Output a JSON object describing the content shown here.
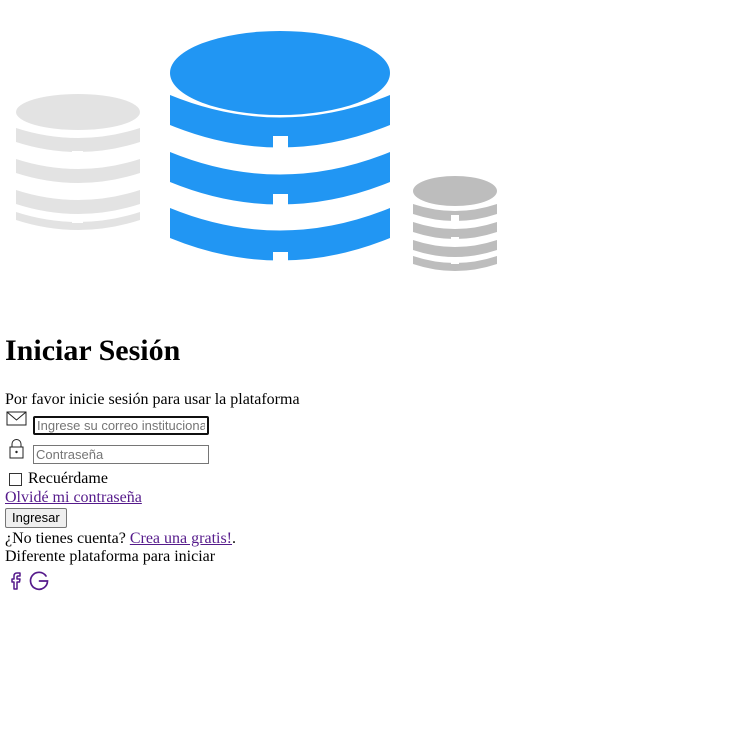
{
  "login": {
    "title": "Iniciar Sesión",
    "subtitle": "Por favor inicie sesión para usar la plataforma",
    "email_placeholder": "Ingrese su correo institucional",
    "password_placeholder": "Contraseña",
    "remember_label": "Recuérdame",
    "forgot_link": "Olvidé mi contraseña",
    "submit_label": "Ingresar",
    "no_account_text": "¿No tienes cuenta? ",
    "signup_link": "Crea una gratis!",
    "signup_suffix": ".",
    "other_platform_text": "Diferente plataforma para iniciar",
    "social_icons": [
      "facebook-icon",
      "google-icon"
    ]
  },
  "colors": {
    "hero_primary": "#2196f3",
    "hero_left": "#e3e3e3",
    "hero_right": "#bdbdbd",
    "link": "#551a8b"
  }
}
